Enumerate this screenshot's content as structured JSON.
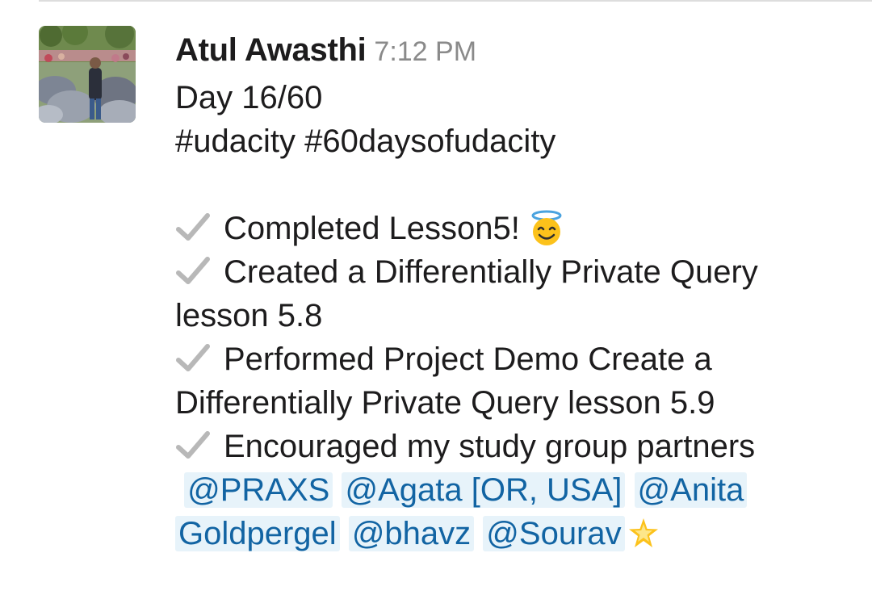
{
  "message": {
    "sender": "Atul Awasthi",
    "timestamp": "7:12 PM",
    "lines": {
      "day": "Day 16/60",
      "hashtags": "#udacity #60daysofudacity",
      "item1": "Completed Lesson5!",
      "item2a": "Created a Differentially Private Query",
      "item2b": "lesson 5.8",
      "item3a": "Performed Project Demo Create a",
      "item3b": "Differentially Private Query lesson 5.9",
      "item4": "Encouraged my study group partners"
    },
    "mentions": {
      "praxs": "@PRAXS",
      "agata": "@Agata [OR, USA]",
      "anita_first": "@Anita",
      "anita_last": "Goldpergel",
      "bhavz": "@bhavz",
      "sourav": "@Sourav"
    },
    "emojis": {
      "check": "heavy-check-mark-icon",
      "halo": "smiling-face-with-halo-icon",
      "star": "glowing-star-icon"
    }
  },
  "colors": {
    "mention_bg": "#e7f3fa",
    "mention_text": "#1264a3",
    "timestamp": "#8a8a8a",
    "text": "#1d1c1d"
  }
}
